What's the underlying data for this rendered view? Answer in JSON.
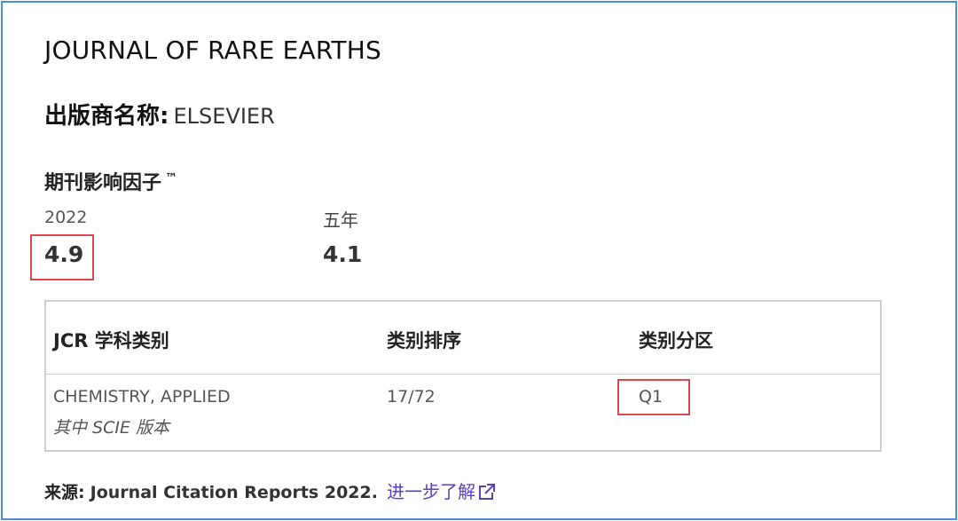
{
  "journal": {
    "title": "JOURNAL OF RARE EARTHS",
    "publisher_label": "出版商名称:",
    "publisher_value": "ELSEVIER"
  },
  "impact_factor": {
    "heading": "期刊影响因子",
    "trademark": "™",
    "year_label": "2022",
    "year_value": "4.9",
    "five_year_label": "五年",
    "five_year_value": "4.1"
  },
  "jcr_table": {
    "headers": [
      "JCR 学科类别",
      "类别排序",
      "类别分区"
    ],
    "rows": [
      {
        "category": "CHEMISTRY, APPLIED",
        "edition": "其中 SCIE 版本",
        "rank": "17/72",
        "quartile": "Q1"
      }
    ]
  },
  "source": {
    "label": "来源:",
    "text": "Journal Citation Reports  2022.",
    "link_text": "进一步了解",
    "link_icon": "external-link-icon"
  },
  "colors": {
    "frame": "#4a90d9",
    "highlight": "#e0474c",
    "link": "#5a3fbf",
    "table_border": "#cfcfcf"
  }
}
